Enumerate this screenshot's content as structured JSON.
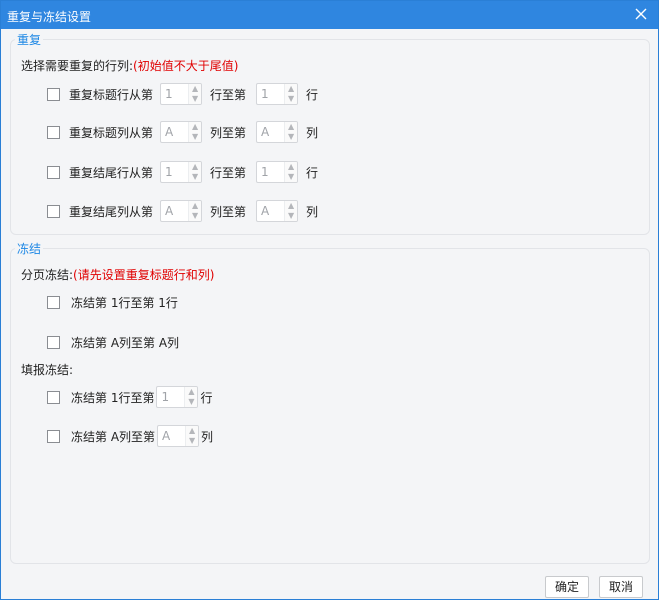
{
  "window": {
    "title": "重复与冻结设置",
    "close_icon": "close-icon"
  },
  "repeat": {
    "section_title": "重复",
    "select_label": "选择需要重复的行列:",
    "select_note": "(初始值不大于尾值)",
    "rows": [
      {
        "label": "重复标题行从第",
        "from": "1",
        "middle": "行至第",
        "to": "1",
        "unit": "行"
      },
      {
        "label": "重复标题列从第",
        "from": "A",
        "middle": "列至第",
        "to": "A",
        "unit": "列"
      },
      {
        "label": "重复结尾行从第",
        "from": "1",
        "middle": "行至第",
        "to": "1",
        "unit": "行"
      },
      {
        "label": "重复结尾列从第",
        "from": "A",
        "middle": "列至第",
        "to": "A",
        "unit": "列"
      }
    ]
  },
  "freeze": {
    "section_title": "冻结",
    "page_label": "分页冻结:",
    "page_note": "(请先设置重复标题行和列)",
    "page_rows": [
      {
        "label": "冻结第 1行至第 1行"
      },
      {
        "label": "冻结第 A列至第 A列"
      }
    ],
    "fill_label": "填报冻结:",
    "fill_rows": [
      {
        "label": "冻结第 1行至第",
        "value": "1",
        "unit": "行"
      },
      {
        "label": "冻结第 A列至第",
        "value": "A",
        "unit": "列"
      }
    ]
  },
  "buttons": {
    "ok": "确定",
    "cancel": "取消"
  }
}
